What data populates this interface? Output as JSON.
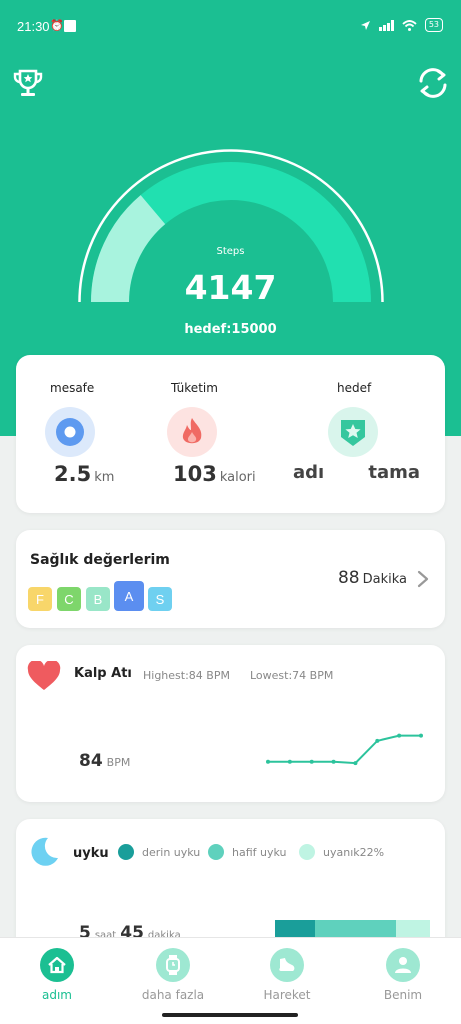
{
  "status_bar": {
    "time": "21:30",
    "battery": "53"
  },
  "colors": {
    "primary": "#1bbf92",
    "gauge_track": "#21e0b0",
    "gauge_fill": "#a8f3de",
    "heart": "#ef5b5f"
  },
  "icons": {
    "top_left": "trophy-icon",
    "top_right": "sync-icon"
  },
  "gauge": {
    "label": "Steps",
    "value": "4147",
    "goal_text": "hedef:15000",
    "progress": 0.2765
  },
  "metrics": [
    {
      "label": "mesafe",
      "value": "2.5",
      "unit": "km",
      "icon": "location-icon"
    },
    {
      "label": "Tüketim",
      "value": "103",
      "unit": "kalori",
      "icon": "flame-icon"
    },
    {
      "label": "hedef",
      "value": "adı",
      "unit": "tama",
      "icon": "star-badge-icon"
    }
  ],
  "health": {
    "title": "Sağlık değerlerim",
    "grades": [
      {
        "letter": "F",
        "color": "#f8d66a"
      },
      {
        "letter": "C",
        "color": "#7ed66b"
      },
      {
        "letter": "B",
        "color": "#99e6c8"
      },
      {
        "letter": "A",
        "color": "#5b8ef0"
      },
      {
        "letter": "S",
        "color": "#6fd0f0"
      }
    ],
    "value": "88",
    "unit": "Dakika"
  },
  "heart_rate": {
    "title": "Kalp Atış",
    "highest": "Highest:84  BPM",
    "lowest": "Lowest:74  BPM",
    "value": "84",
    "unit": "BPM",
    "chart_data": {
      "type": "line",
      "values": [
        74,
        74,
        74,
        74,
        73.5,
        82,
        84,
        84
      ]
    }
  },
  "sleep": {
    "title": "uyku",
    "legend": [
      {
        "label": "derin uyku",
        "color": "#1a9e9a"
      },
      {
        "label": "hafif uyku",
        "color": "#5fd1bd"
      },
      {
        "label": "uyanık22%",
        "color": "#bff4e3"
      }
    ],
    "hours": "5",
    "hours_unit": "saat",
    "minutes": "45",
    "minutes_unit": "dakika",
    "bar": [
      {
        "fraction": 0.26,
        "color": "#1a9e9a"
      },
      {
        "fraction": 0.52,
        "color": "#5fd1bd"
      },
      {
        "fraction": 0.22,
        "color": "#bff4e3"
      }
    ]
  },
  "nav": [
    {
      "label": "adım",
      "active": true,
      "icon": "home-icon"
    },
    {
      "label": "daha fazla",
      "active": false,
      "icon": "watch-icon"
    },
    {
      "label": "Hareket",
      "active": false,
      "icon": "shoe-icon"
    },
    {
      "label": "Benim",
      "active": false,
      "icon": "person-icon"
    }
  ]
}
